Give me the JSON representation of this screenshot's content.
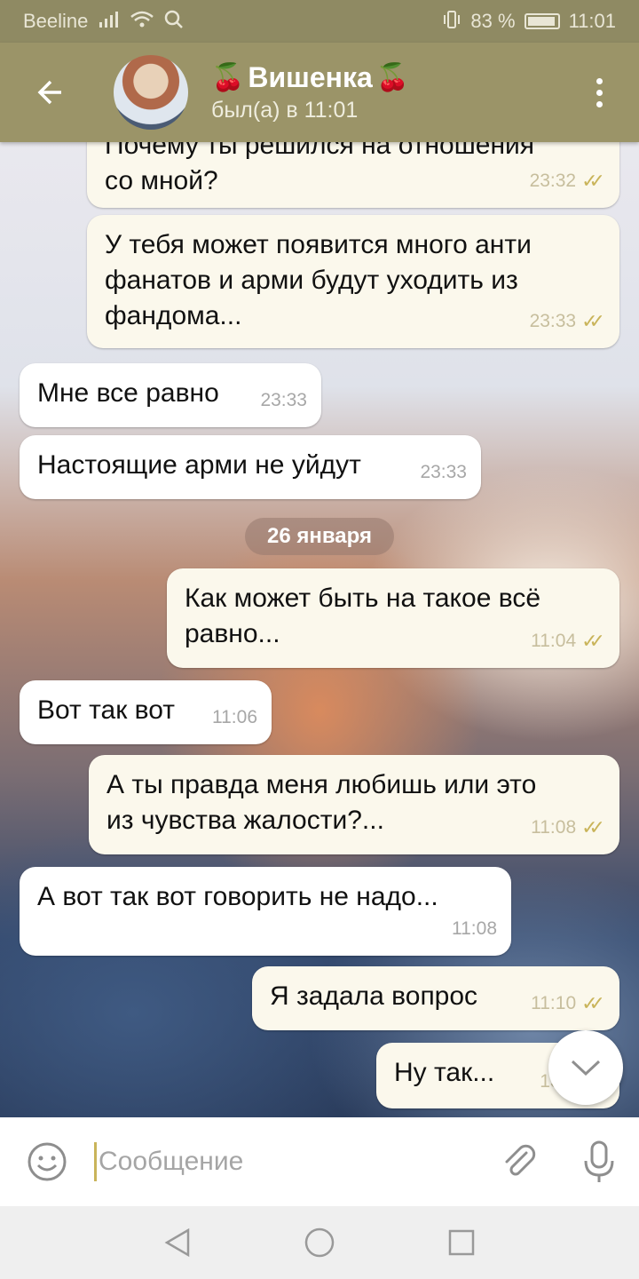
{
  "status_bar": {
    "carrier": "Beeline",
    "battery": "83 %",
    "battery_level": 0.83,
    "time": "11:01"
  },
  "header": {
    "name": "Вишенка",
    "cherry_left": "🍒",
    "cherry_right": "🍒",
    "last_seen": "был(а) в 11:01"
  },
  "messages": [
    {
      "dir": "out",
      "text": "Почему ты решился на отношения\nсо мной?",
      "time": "23:32",
      "read": true
    },
    {
      "dir": "out",
      "text": "У тебя может появится много анти\nфанатов и арми будут уходить из\nфандома...",
      "time": "23:33",
      "read": true
    },
    {
      "dir": "in",
      "text": "Мне все равно",
      "time": "23:33"
    },
    {
      "dir": "in",
      "text": "Настоящие арми не уйдут",
      "time": "23:33"
    },
    {
      "dir": "out",
      "text": "Как может быть на такое всё\nравно...",
      "time": "11:04",
      "read": true
    },
    {
      "dir": "in",
      "text": "Вот так вот",
      "time": "11:06"
    },
    {
      "dir": "out",
      "text": "А ты правда меня любишь или это\nиз чувства жалости?...",
      "time": "11:08",
      "read": true
    },
    {
      "dir": "in",
      "text": "А вот так вот говорить не надо...",
      "time": "11:08"
    },
    {
      "dir": "out",
      "text": "Я задала вопрос",
      "time": "11:10",
      "read": true
    },
    {
      "dir": "out",
      "text": "Ну так...",
      "time": "13:2",
      "read": true
    }
  ],
  "date_separator": "26 января",
  "input": {
    "placeholder": "Сообщение",
    "value": ""
  }
}
